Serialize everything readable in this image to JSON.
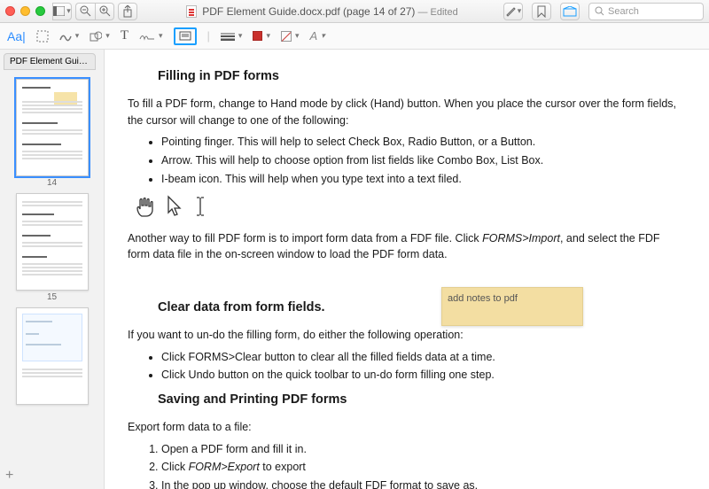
{
  "title": {
    "filename": "PDF Element Guide.docx.pdf",
    "page_info": " (page 14 of 27)",
    "edited": " — Edited"
  },
  "search": {
    "placeholder": "Search"
  },
  "toolbar": {
    "aa": "Aa|",
    "text_t": "T",
    "styleA": "A"
  },
  "sidebar": {
    "tab_label": "PDF Element Guide.docx.pdf",
    "pages": [
      "14",
      "15"
    ]
  },
  "doc": {
    "h1": "Filling in PDF forms",
    "p1a": "To fill a PDF form, change to Hand mode by click (Hand) button. When you place the cursor over the form fields, the cursor will change to one of the following:",
    "li1": "Pointing finger. This will help to select Check Box, Radio Button, or a Button.",
    "li2": "Arrow. This will help to choose option from list fields like Combo Box, List Box.",
    "li3": "I-beam icon. This will help when you type text into a text filed.",
    "p2a": "Another way to fill PDF form is to import form data from a FDF file. Click ",
    "p2b": "FORMS>Import",
    "p2c": ", and select the FDF form data file in the on-screen window to load the PDF form data.",
    "note_text": "add notes to pdf",
    "h2": "Clear data from form fields.",
    "p3": "If you want to un-do the filling form, do either the following operation:",
    "li4": "Click FORMS>Clear button to clear all the filled fields data at a time.",
    "li5": "Click Undo button on the quick toolbar to un-do form filling one step.",
    "h3": "Saving and Printing PDF forms",
    "p4": "Export form data to a file:",
    "ol1": "Open a PDF form and fill it in.",
    "ol2a": "Click ",
    "ol2b": "FORM>Export",
    "ol2c": " to export",
    "ol3": "In the pop up window, choose the default FDF format to save as."
  }
}
